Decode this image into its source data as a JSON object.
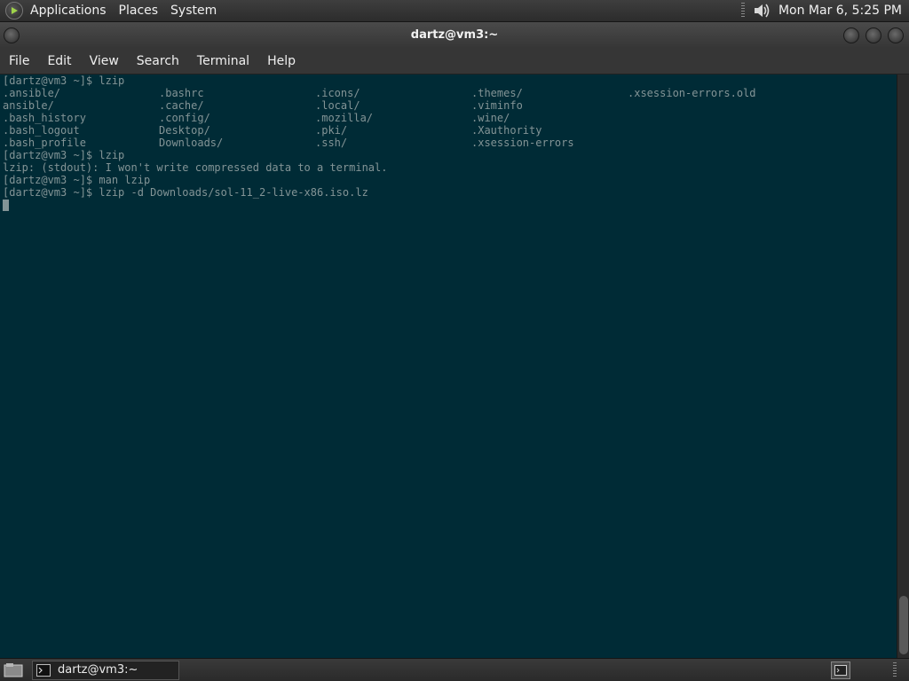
{
  "top_panel": {
    "menus": [
      "Applications",
      "Places",
      "System"
    ],
    "clock": "Mon Mar  6,  5:25 PM",
    "logo_icon": "distro-logo-icon",
    "volume_icon": "volume-icon"
  },
  "window": {
    "title": "dartz@vm3:~"
  },
  "menubar": {
    "items": [
      "File",
      "Edit",
      "View",
      "Search",
      "Terminal",
      "Help"
    ]
  },
  "terminal": {
    "line0": "[dartz@vm3 ~]$ lzip",
    "ls_rows": [
      [
        ".ansible/",
        ".bashrc",
        ".icons/",
        ".themes/",
        ".xsession-errors.old"
      ],
      [
        "ansible/",
        ".cache/",
        ".local/",
        ".viminfo",
        ""
      ],
      [
        ".bash_history",
        ".config/",
        ".mozilla/",
        ".wine/",
        ""
      ],
      [
        ".bash_logout",
        "Desktop/",
        ".pki/",
        ".Xauthority",
        ""
      ],
      [
        ".bash_profile",
        "Downloads/",
        ".ssh/",
        ".xsession-errors",
        ""
      ]
    ],
    "line6": "[dartz@vm3 ~]$ lzip",
    "line7": "lzip: (stdout): I won't write compressed data to a terminal.",
    "line8": "[dartz@vm3 ~]$ man lzip",
    "line9": "[dartz@vm3 ~]$ lzip -d Downloads/sol-11_2-live-x86.iso.lz",
    "colors": {
      "background": "#002b36",
      "foreground": "#839496"
    }
  },
  "bottom_panel": {
    "task_label": "dartz@vm3:~",
    "task_icon": "terminal-icon",
    "show_desktop_icon": "show-desktop-icon",
    "workspace_icon": "workspace-switcher-icon"
  }
}
